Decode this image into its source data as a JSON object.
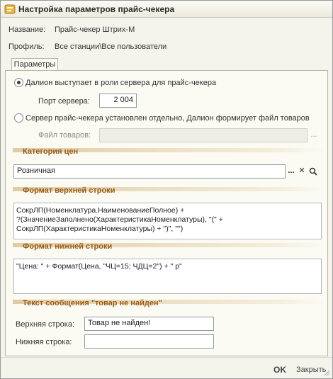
{
  "window": {
    "title": "Настройка параметров прайс-чекера"
  },
  "header": {
    "name_label": "Название:",
    "name_value": "Прайс-чекер Штрих-М",
    "profile_label": "Профиль:",
    "profile_value": "Все станции\\Все пользователи"
  },
  "tabs": {
    "params": "Параметры"
  },
  "server": {
    "option_server": "Далион выступает в роли сервера для прайс-чекера",
    "port_label": "Порт сервера:",
    "port_value": "2 004",
    "option_file": "Сервер прайс-чекера установлен отдельно, Далион формирует файл товаров",
    "file_label": "Файл товаров:",
    "file_value": "",
    "file_button": "..."
  },
  "price_category": {
    "title": "Категория цен",
    "value": "Розничная",
    "select_button": "...",
    "clear_button": "✕"
  },
  "top_format": {
    "title": "Формат верхней строки",
    "text": "СокрЛП(Номенклатура.НаименованиеПолное) +\n?(ЗначениеЗаполнено(ХарактеристикаНоменклатуры), \"(\" +\nСокрЛП(ХарактеристикаНоменклатуры) + \")\", \"\")"
  },
  "bottom_format": {
    "title": "Формат нижней строки",
    "text": "\"Цена: \" + Формат(Цена, \"ЧЦ=15; ЧДЦ=2\") + \" р\""
  },
  "not_found": {
    "title": "Текст сообщения \"товар не найден\"",
    "top_label": "Верхняя строка:",
    "top_value": "Товар не найден!",
    "bottom_label": "Нижняя строка:",
    "bottom_value": ""
  },
  "footer": {
    "ok": "OK",
    "close": "Закрыть"
  }
}
